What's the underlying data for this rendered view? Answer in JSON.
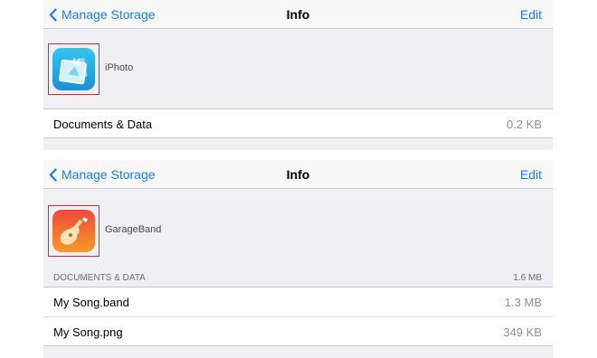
{
  "screens": [
    {
      "nav": {
        "back_label": "Manage Storage",
        "title": "Info",
        "edit_label": "Edit"
      },
      "app": {
        "name": "iPhoto",
        "icon": "iphoto-app-icon"
      },
      "rows": [
        {
          "label": "Documents & Data",
          "value": "0.2 KB"
        }
      ]
    },
    {
      "nav": {
        "back_label": "Manage Storage",
        "title": "Info",
        "edit_label": "Edit"
      },
      "app": {
        "name": "GarageBand",
        "icon": "garageband-app-icon"
      },
      "section": {
        "label": "DOCUMENTS & DATA",
        "total": "1.6 MB"
      },
      "rows": [
        {
          "label": "My Song.band",
          "value": "1.3 MB"
        },
        {
          "label": "My Song.png",
          "value": "349 KB"
        }
      ]
    }
  ],
  "colors": {
    "accent": "#157efb",
    "highlight_box": "#e0272c",
    "background": "#efeff4"
  }
}
